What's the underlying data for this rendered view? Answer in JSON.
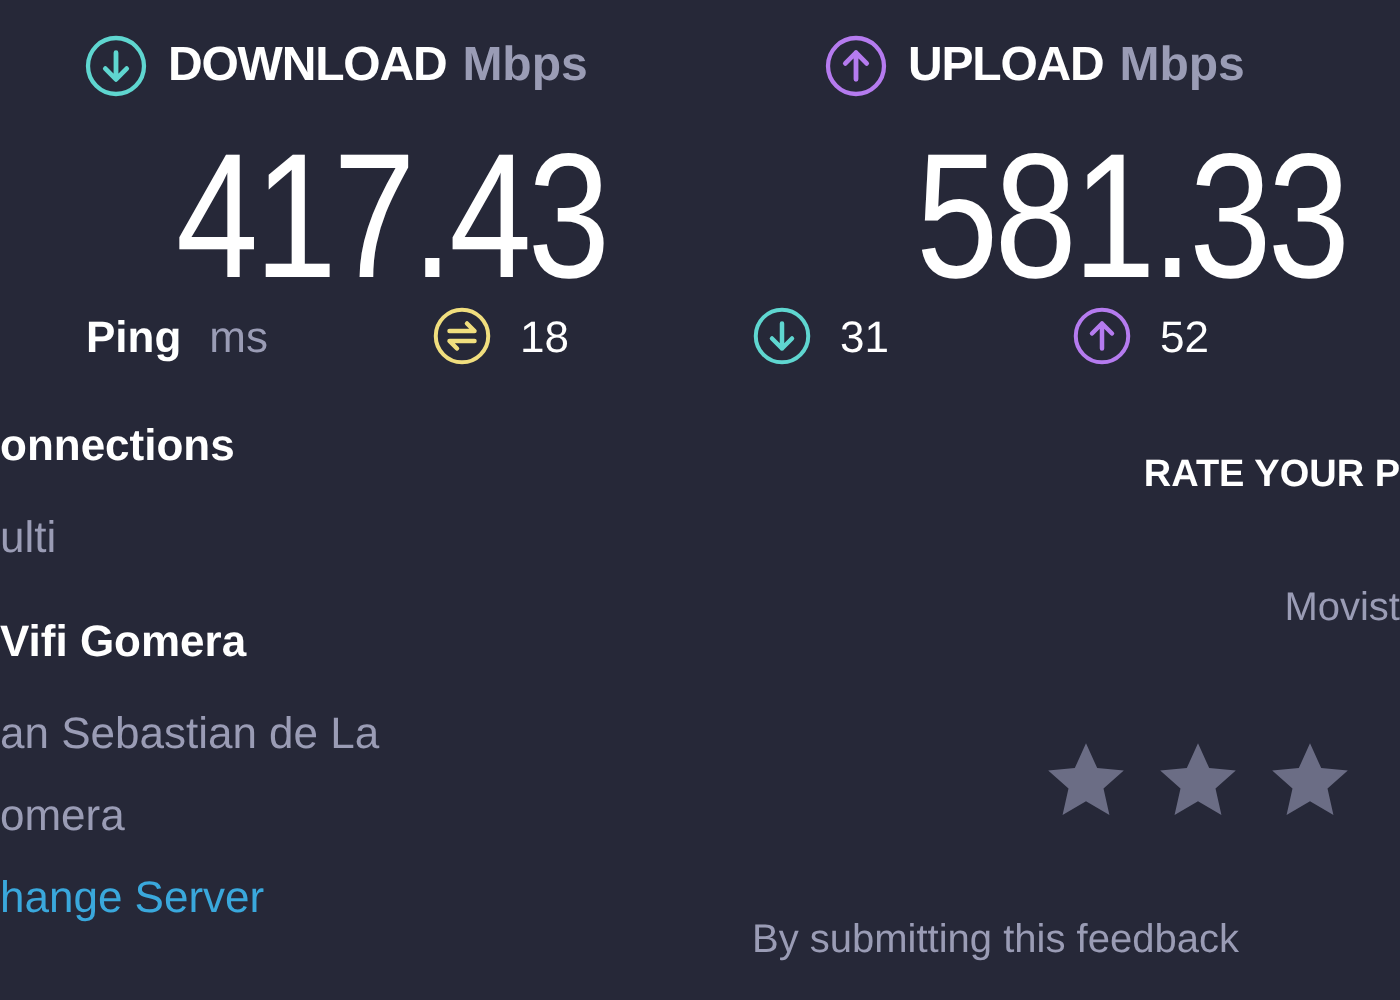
{
  "download": {
    "label": "DOWNLOAD",
    "unit": "Mbps",
    "value": "417.43"
  },
  "upload": {
    "label": "UPLOAD",
    "unit": "Mbps",
    "value": "581.33"
  },
  "ping": {
    "label": "Ping",
    "unit": "ms",
    "metrics": [
      {
        "kind": "idle",
        "value": "18"
      },
      {
        "kind": "download",
        "value": "31"
      },
      {
        "kind": "upload",
        "value": "52"
      }
    ]
  },
  "connections": {
    "title": "onnections",
    "value": "ulti"
  },
  "server": {
    "name": "Vifi Gomera",
    "location_lines": [
      "an Sebastian de La",
      "omera"
    ],
    "link": "hange Server"
  },
  "rating": {
    "title": "RATE YOUR P",
    "provider": "Movist",
    "note": "By submitting this feedback"
  }
}
